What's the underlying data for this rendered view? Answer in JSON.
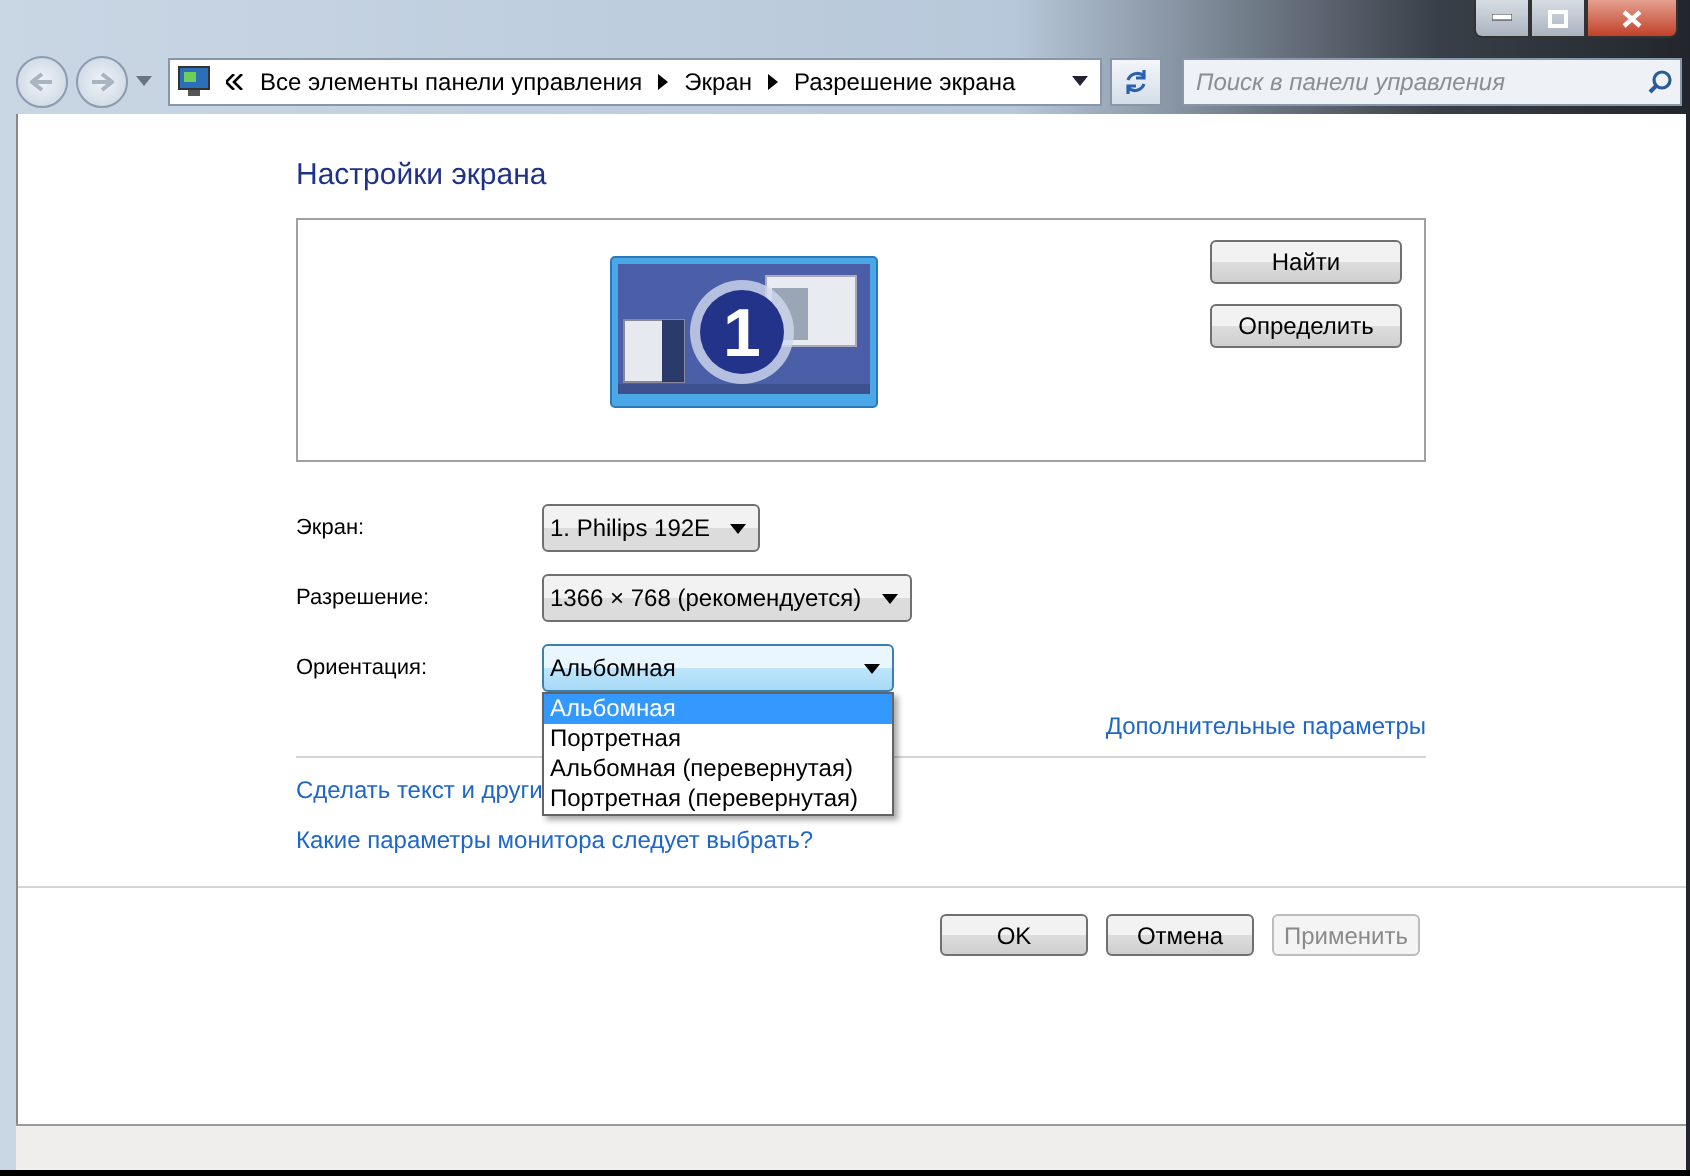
{
  "address_bar": {
    "breadcrumbs": [
      "Все элементы панели управления",
      "Экран",
      "Разрешение экрана"
    ],
    "search": {
      "placeholder": "Поиск в панели управления"
    }
  },
  "title": "Настройки экрана",
  "monitor_buttons": [
    {
      "label": "Найти",
      "disabled": false
    },
    {
      "label": "Определить",
      "disabled": false
    }
  ],
  "display_number": "1",
  "fields": [
    {
      "label": "Экран:",
      "value": "1. Philips 192E",
      "open": false
    },
    {
      "label": "Разрешение:",
      "value": "1366 × 768 (рекомендуется)",
      "open": false
    },
    {
      "label": "Ориентация:",
      "value": "Альбомная",
      "open": true
    }
  ],
  "orientation_options": [
    {
      "label": "Альбомная",
      "selected": true
    },
    {
      "label": "Портретная",
      "selected": false
    },
    {
      "label": "Альбомная (перевернутая)",
      "selected": false
    },
    {
      "label": "Портретная (перевернутая)",
      "selected": false
    }
  ],
  "advanced_link": "Дополнительные параметры",
  "links": [
    "Сделать текст и други",
    "Какие параметры монитора следует выбрать?"
  ],
  "buttons": [
    {
      "label": "OK",
      "disabled": false
    },
    {
      "label": "Отмена",
      "disabled": false
    },
    {
      "label": "Применить",
      "disabled": true
    }
  ]
}
